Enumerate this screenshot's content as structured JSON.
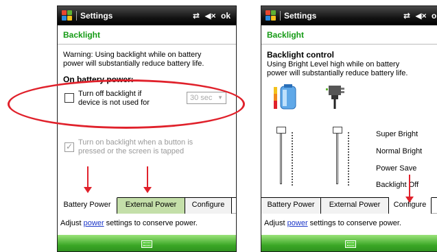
{
  "left_screen": {
    "titlebar": {
      "title": "Settings",
      "icons": [
        "connectivity-icon",
        "volume-mute-icon"
      ],
      "ok_label": "ok"
    },
    "heading": "Backlight",
    "warning_line1": "Warning: Using backlight while on battery",
    "warning_line2": "power will substantially reduce battery life.",
    "section_label": "On battery power:",
    "option1_line1": "Turn off backlight if",
    "option1_line2": "device is not used for",
    "option1_checked": false,
    "timeout_value": "30 sec",
    "option2_line1": "Turn on backlight when a button is",
    "option2_line2": "pressed or the screen is tapped",
    "option2_checked": true,
    "tabs": [
      "Battery Power",
      "External Power",
      "Configure"
    ],
    "active_tab": "Battery Power",
    "footer_prefix": "Adjust",
    "footer_link": "power",
    "footer_suffix": "settings to conserve power."
  },
  "right_screen": {
    "titlebar": {
      "title": "Settings",
      "icons": [
        "connectivity-icon",
        "volume-mute-icon"
      ],
      "ok_label": "ok"
    },
    "heading": "Backlight",
    "section_label": "Backlight control",
    "desc_line1": "Using Bright Level high while on battery",
    "desc_line2": "power will substantially reduce battery life.",
    "levels": [
      "Super Bright",
      "Normal Bright",
      "Power Save",
      "Backlight Off"
    ],
    "tabs": [
      "Battery Power",
      "External Power",
      "Configure"
    ],
    "active_tab": "Configure",
    "footer_prefix": "Adjust",
    "footer_link": "power",
    "footer_suffix": "settings to conserve power."
  },
  "colors": {
    "heading_green": "#139a13",
    "annotation_red": "#e0212b",
    "link_blue": "#1a35c8",
    "softbar_green": "#3aa626"
  }
}
